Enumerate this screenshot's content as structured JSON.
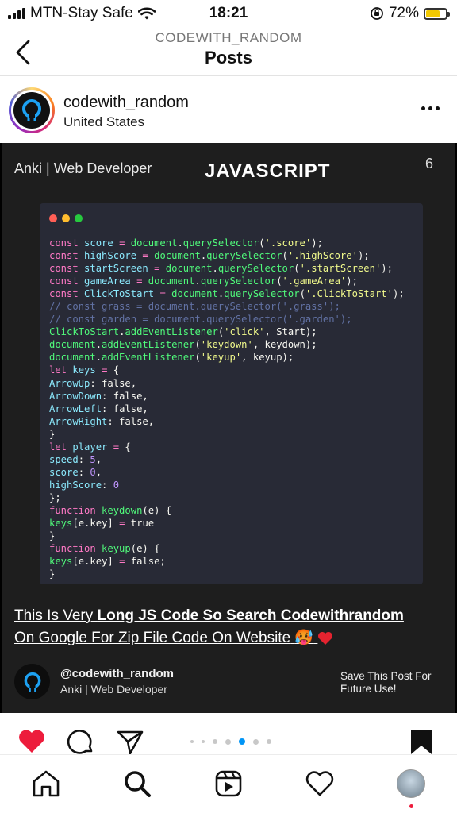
{
  "status_bar": {
    "carrier": "MTN-Stay Safe",
    "time": "18:21",
    "battery_percent": "72%",
    "battery_level": 0.72,
    "battery_color": "#f2c900"
  },
  "nav": {
    "subtitle": "CODEWITH_RANDOM",
    "title": "Posts"
  },
  "post_header": {
    "username": "codewith_random",
    "location": "United States"
  },
  "post_image": {
    "author_tag": "Anki | Web Developer",
    "heading": "JAVASCRIPT",
    "page_number": "6",
    "window_dot_colors": [
      "#ff5f56",
      "#ffbd2e",
      "#27c93f"
    ],
    "code_lines": [
      "const score = document.querySelector('.score');",
      "const highScore = document.querySelector('.highScore');",
      "const startScreen = document.querySelector('.startScreen');",
      "const gameArea = document.querySelector('.gameArea');",
      "const ClickToStart = document.querySelector('.ClickToStart');",
      "// const grass = document.querySelector('.grass');",
      "// const garden = document.querySelector('.garden');",
      "ClickToStart.addEventListener('click', Start);",
      "document.addEventListener('keydown', keydown);",
      "document.addEventListener('keyup', keyup);",
      "let keys = {",
      "ArrowUp: false,",
      "ArrowDown: false,",
      "ArrowLeft: false,",
      "ArrowRight: false,",
      "}",
      "let player = {",
      "speed: 5,",
      "score: 0,",
      "highScore: 0",
      "};",
      "function keydown(e) {",
      "keys[e.key] = true",
      "}",
      "function keyup(e) {",
      "keys[e.key] = false;",
      "}"
    ],
    "caption_part1": "This Is Very ",
    "caption_part2": "Long JS Code So Search Codewithrandom",
    "caption_part3": "On Google For Zip File Code On Website",
    "caption_emoji": "🥵",
    "footer_handle": "@codewith_random",
    "footer_subtitle": "Anki | Web Developer",
    "footer_save_line1": "Save This Post For",
    "footer_save_line2": "Future Use!"
  },
  "actions": {
    "liked": true,
    "like_color": "#ed1c3c",
    "carousel_total": 7,
    "carousel_active_index": 4
  },
  "tab_bar": {
    "items": [
      "home-icon",
      "search-icon",
      "reels-icon",
      "activity-heart-icon",
      "profile-avatar"
    ]
  }
}
